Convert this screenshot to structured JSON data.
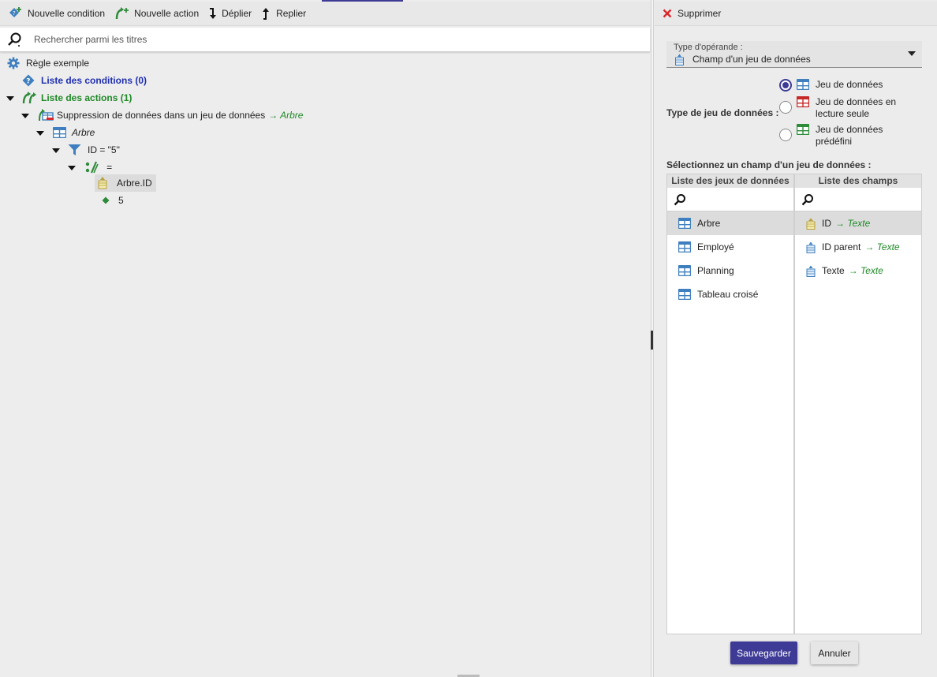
{
  "toolbar": {
    "new_condition": "Nouvelle condition",
    "new_action": "Nouvelle action",
    "expand": "Déplier",
    "collapse": "Replier"
  },
  "search": {
    "placeholder": "Rechercher parmi les titres"
  },
  "tree": {
    "rule": "Règle exemple",
    "conditions": "Liste des conditions (0)",
    "actions": "Liste des actions (1)",
    "delete_action": "Suppression de données dans un jeu de données",
    "delete_action_target": "→ Arbre",
    "dataset": "Arbre",
    "filter": "ID = \"5\"",
    "operator": "=",
    "field": "Arbre.ID",
    "value": "5"
  },
  "panel": {
    "delete": "Supprimer",
    "operand_type_label": "Type d'opérande :",
    "operand_type_value": "Champ d'un jeu de données",
    "dataset_type_label": "Type de jeu de données :",
    "dataset_types": [
      {
        "label": "Jeu de données",
        "checked": true
      },
      {
        "label": "Jeu de données en lecture seule",
        "checked": false
      },
      {
        "label": "Jeu de données prédéfini",
        "checked": false
      }
    ],
    "select_field_label": "Sélectionnez un champ d'un jeu de données :",
    "datasets_header": "Liste des jeux de données",
    "fields_header": "Liste des champs",
    "datasets": [
      "Arbre",
      "Employé",
      "Planning",
      "Tableau croisé"
    ],
    "fields": [
      {
        "name": "ID",
        "type": "→ Texte"
      },
      {
        "name": "ID parent",
        "type": "→ Texte"
      },
      {
        "name": "Texte",
        "type": "→ Texte"
      }
    ],
    "save": "Sauvegarder",
    "cancel": "Annuler"
  },
  "colors": {
    "accent": "#3e3b97",
    "blue": "#1f2fb1",
    "green": "#1e8a26",
    "delete_red": "#d9262c",
    "table_blue": "#3f7fbf",
    "readonly_red": "#c62828",
    "predefined_green": "#2e8b3a"
  }
}
